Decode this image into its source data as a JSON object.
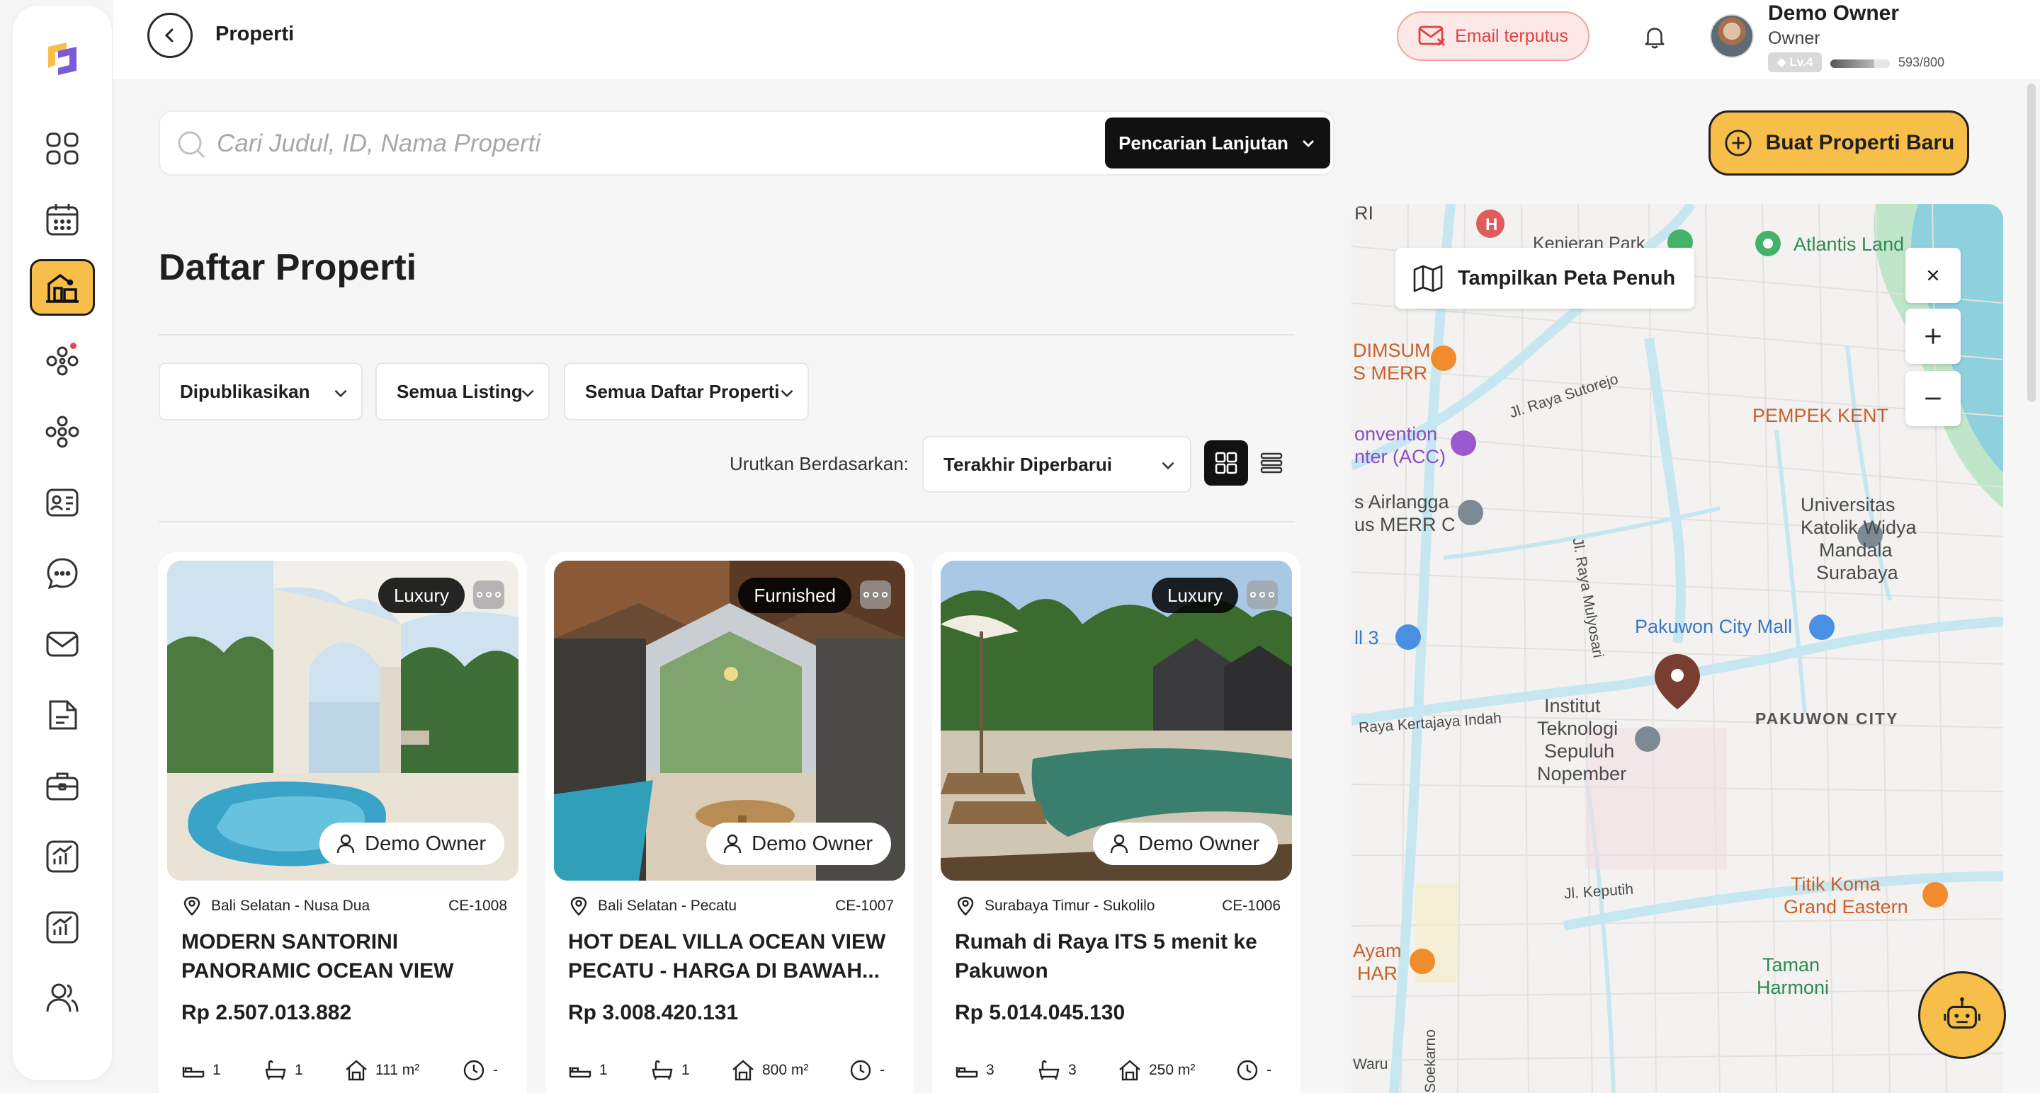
{
  "topbar": {
    "page_title": "Properti",
    "email_status": "Email terputus",
    "user": {
      "name": "Demo Owner",
      "role": "Owner",
      "level": "Lv.4",
      "xp_text": "593/800",
      "xp_progress": 0.741
    }
  },
  "search": {
    "placeholder": "Cari Judul, ID, Nama Properti",
    "advanced_label": "Pencarian Lanjutan"
  },
  "create_button": "Buat Properti Baru",
  "main": {
    "title": "Daftar Properti",
    "filters": [
      "Dipublikasikan",
      "Semua Listing",
      "Semua Daftar Properti"
    ],
    "sort_label": "Urutkan Berdasarkan:",
    "sort_value": "Terakhir Diperbarui"
  },
  "listings": [
    {
      "tag": "Luxury",
      "owner": "Demo Owner",
      "location": "Bali Selatan - Nusa Dua",
      "code": "CE-1008",
      "title": "MODERN SANTORINI PANORAMIC OCEAN VIEW NUS...",
      "price": "Rp 2.507.013.882",
      "beds": "1",
      "baths": "1",
      "area": "111 m²",
      "time": "-"
    },
    {
      "tag": "Furnished",
      "owner": "Demo Owner",
      "location": "Bali Selatan - Pecatu",
      "code": "CE-1007",
      "title": "HOT DEAL VILLA OCEAN VIEW PECATU - HARGA DI BAWAH...",
      "price": "Rp 3.008.420.131",
      "beds": "1",
      "baths": "1",
      "area": "800 m²",
      "time": "-"
    },
    {
      "tag": "Luxury",
      "owner": "Demo Owner",
      "location": "Surabaya Timur - Sukolilo",
      "code": "CE-1006",
      "title": "Rumah di Raya ITS 5 menit ke Pakuwon",
      "price": "Rp 5.014.045.130",
      "beds": "3",
      "baths": "3",
      "area": "250 m²",
      "time": "-"
    }
  ],
  "map": {
    "full_map_label": "Tampilkan Peta Penuh",
    "labels": {
      "atlantis": "Atlantis Land",
      "kenjeran": "Kenjeran Park",
      "dimsum": "DIMSUM",
      "smerr": "S MERR",
      "convention": "onvention",
      "acc": "nter (ACC)",
      "sutorejo": "Jl. Raya Sutorejo",
      "pempek": "PEMPEK KENT",
      "airlangga": "s Airlangga",
      "merrc": "us MERR C",
      "mulyosari": "Jl. Raya Mulyosari",
      "univ1": "Universitas",
      "univ2": "Katolik Widya",
      "univ3": "Mandala",
      "univ4": "Surabaya",
      "mall": "Pakuwon City Mall",
      "l3": "ll 3",
      "pakuwon_city": "PAKUWON CITY",
      "kertajaya": "Raya Kertajaya Indah",
      "its1": "Institut",
      "its2": "Teknologi",
      "its3": "Sepuluh",
      "its4": "Nopember",
      "keputih": "Jl. Keputih",
      "titik1": "Titik Koma",
      "titik2": "Grand Eastern",
      "ayam": "Ayam",
      "har": "HAR",
      "taman1": "Taman",
      "taman2": "Harmoni",
      "soekarno": "Soekarno",
      "waru": "Waru",
      "ri": "RI"
    }
  },
  "colors": {
    "accent": "#f7bf4a",
    "danger": "#e14141",
    "dark": "#111111",
    "map_water": "#8fd0df",
    "map_road": "#c6e7f1",
    "pin": "#7a3d32"
  }
}
